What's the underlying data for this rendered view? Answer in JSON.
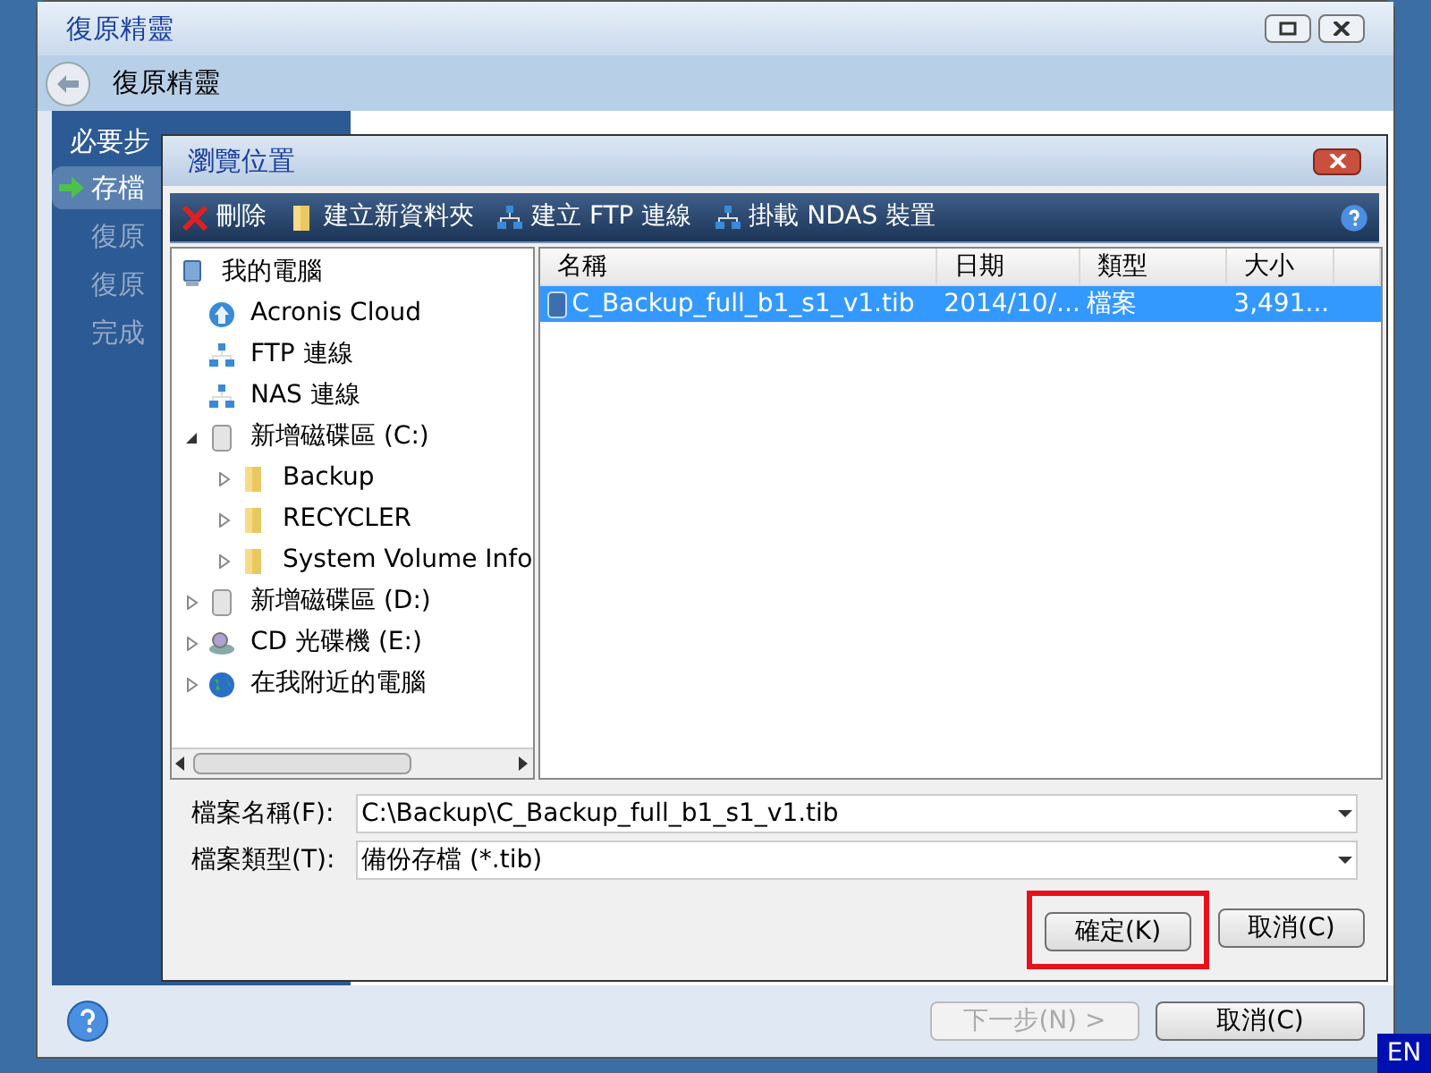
{
  "wizard": {
    "title": "復原精靈",
    "header": "復原精靈",
    "sidebar": {
      "heading": "必要步",
      "items": [
        {
          "label": "存檔",
          "selected": true
        },
        {
          "label": "復原",
          "selected": false
        },
        {
          "label": "復原",
          "selected": false
        },
        {
          "label": "完成",
          "selected": false
        }
      ]
    },
    "buttons": [
      {
        "label": "下一步(N) >",
        "disabled": true
      },
      {
        "label": "取消(C)",
        "disabled": false
      }
    ]
  },
  "dialog": {
    "title": "瀏覽位置",
    "toolbar": [
      {
        "label": "刪除",
        "kind": "delete"
      },
      {
        "label": "建立新資料夾",
        "kind": "folder"
      },
      {
        "label": "建立 FTP 連線",
        "kind": "network"
      },
      {
        "label": "掛載 NDAS 裝置",
        "kind": "network"
      }
    ],
    "tree": [
      {
        "label": "我的電腦",
        "kind": "computer",
        "children": [
          {
            "label": "Acronis Cloud",
            "kind": "cloud"
          },
          {
            "label": "FTP 連線",
            "kind": "network"
          },
          {
            "label": "NAS 連線",
            "kind": "network"
          },
          {
            "label": "新增磁碟區 (C:)",
            "kind": "drive",
            "expanded": true,
            "children": [
              {
                "label": "Backup",
                "kind": "folder",
                "expanded": false
              },
              {
                "label": "RECYCLER",
                "kind": "folder",
                "expanded": false
              },
              {
                "label": "System Volume Info",
                "kind": "folder",
                "expanded": false
              }
            ]
          },
          {
            "label": "新增磁碟區 (D:)",
            "kind": "drive",
            "expanded": false
          },
          {
            "label": "CD 光碟機 (E:)",
            "kind": "cd",
            "expanded": false
          },
          {
            "label": "在我附近的電腦",
            "kind": "globe",
            "expanded": false
          }
        ]
      }
    ],
    "columns": [
      "名稱",
      "日期",
      "類型",
      "大小"
    ],
    "rows": [
      {
        "cells": [
          "C_Backup_full_b1_s1_v1.tib",
          "2014/10/...",
          "檔案",
          "3,491..."
        ],
        "selected": true
      }
    ],
    "fields": [
      {
        "label": "檔案名稱(F):",
        "value": "C:\\Backup\\C_Backup_full_b1_s1_v1.tib"
      },
      {
        "label": "檔案類型(T):",
        "value": "備份存檔 (*.tib)"
      }
    ],
    "buttons": [
      {
        "label": "確定(K)",
        "highlighted": true
      },
      {
        "label": "取消(C)",
        "highlighted": false
      }
    ]
  },
  "language": "EN"
}
